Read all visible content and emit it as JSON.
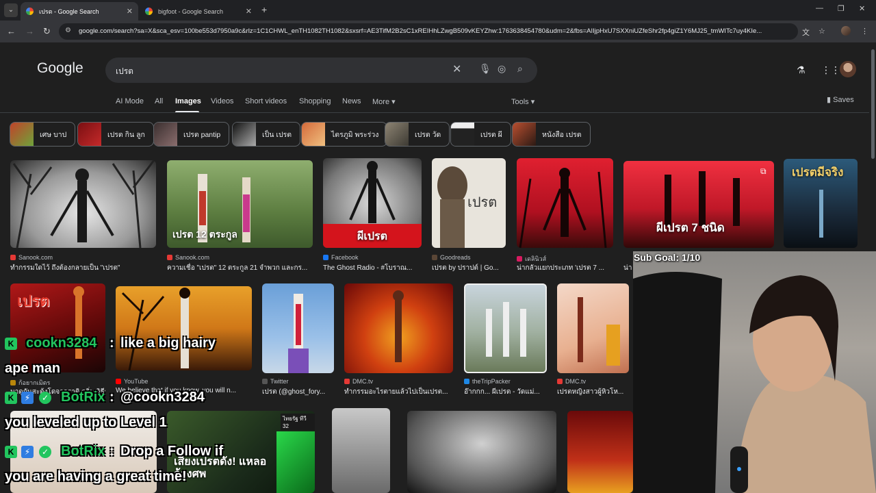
{
  "browser": {
    "tabs": [
      {
        "title": "เปรต - Google Search",
        "active": true
      },
      {
        "title": "bigfoot - Google Search",
        "active": false
      }
    ],
    "url": "google.com/search?sa=X&sca_esv=100be553d7950a9c&rlz=1C1CHWL_enTH1082TH1082&sxsrf=AE3TifM2B2sC1xREIHhLZwgB509vKEYZhw:1763638454780&udm=2&fbs=AIIjpHxU7SXXniUZfeShr2fp4giZ1Y6MJ25_tmWITc7uy4KIe..."
  },
  "google": {
    "logo": "Google",
    "query": "เปรต",
    "tabs": [
      "AI Mode",
      "All",
      "Images",
      "Videos",
      "Short videos",
      "Shopping",
      "News",
      "More"
    ],
    "active_tab": "Images",
    "more_label": "More",
    "tools_label": "Tools",
    "saves_label": "Saves"
  },
  "chips": [
    {
      "label": "เศษ บาป",
      "color": "#a23a1e"
    },
    {
      "label": "เปรต กิน ลูก",
      "color": "#8a1418"
    },
    {
      "label": "เปรต pantip",
      "color": "#4a3a3a"
    },
    {
      "label": "เป็น เปรต",
      "color": "#333333"
    },
    {
      "label": "ไตรภูมิ พระร่วง",
      "color": "#b04a28"
    },
    {
      "label": "เปรต วัด",
      "color": "#5a5346"
    },
    {
      "label": "เปรต ผี",
      "color": "#3d3d3d"
    },
    {
      "label": "หนังสือ เปรต",
      "color": "#6a3424"
    }
  ],
  "row1": [
    {
      "source": "Sanook.com",
      "title": "ทำกรรมใดไว้ ถึงต้องกลายเป็น \"เปรต\"",
      "src_color": "#e53935"
    },
    {
      "source": "Sanook.com",
      "title": "ความเชื่อ \"เปรต\" 12 ตระกูล 21 จำพวก และกร...",
      "overlay": "เปรต 12 ตระกูล",
      "src_color": "#e53935"
    },
    {
      "source": "Facebook",
      "title": "The Ghost Radio - #โบราณ...",
      "overlay": "ผีเปรต",
      "src_color": "#1877f2"
    },
    {
      "source": "Goodreads",
      "title": "เปรต by ปราปต์ | Go...",
      "overlay": "เปรต",
      "src_color": "#5a4636"
    },
    {
      "source": "เดลินิวส์",
      "title": "น่ากลัวแยกประเภท 'เปรต 7 ...",
      "src_color": "#d81b60"
    },
    {
      "source": "",
      "title": "น่า",
      "overlay": "ผีเปรต 7 ชนิด",
      "src_color": "#d81b60"
    },
    {
      "source": "",
      "title": "",
      "overlay": "เปรตมีจริง",
      "src_color": "#888888"
    }
  ],
  "row2": [
    {
      "source": "ก้อยากเมิตร",
      "title": "มาดูกันสะดุ้งโดจากราดิ กลิ่น วิธีรา",
      "overlay": "เปรต",
      "src_color": "#b8860b"
    },
    {
      "source": "YouTube",
      "title": "We believe that if you know, you will n...",
      "src_color": "#ff0000"
    },
    {
      "source": "Twitter",
      "title": "เปรต (@ghost_fory...",
      "src_color": "#555555"
    },
    {
      "source": "DMC.tv",
      "title": "ทำกรรมอะไรตายแล้วไปเป็นเปรต...",
      "src_color": "#e53935"
    },
    {
      "source": "theTripPacker",
      "title": "อ๊ากกก... ผีเปรต - วัดแม่...",
      "src_color": "#1e88e5"
    },
    {
      "source": "DMC.tv",
      "title": "เปรตหญิงสาวผู้หิวโห...",
      "src_color": "#e53935"
    }
  ],
  "row3": [
    {
      "overlay": ""
    },
    {
      "overlay": "เสียงเปรตดัง! แหลอล้างศพ",
      "tag": "ไทยรัฐ ทีวี 32"
    },
    {
      "overlay": ""
    },
    {
      "overlay": ""
    },
    {
      "overlay": ""
    }
  ],
  "stream": {
    "sub_goal": "Sub Goal: 1/10",
    "chat": [
      {
        "user": "cookn3284",
        "sep": " : ",
        "msg": "like a big hairy",
        "msg2": "ape man"
      },
      {
        "user": "BotRix",
        "sep": " : ",
        "msg": "@cookn3284",
        "msg2": "you leveled up to Level 1"
      },
      {
        "user": "BotRix",
        "sep": " : ",
        "msg": "Drop a Follow if",
        "msg2": "you are having a great time!"
      }
    ],
    "badge_k": "K",
    "colors": {
      "user": "#22c55e",
      "msg": "#ffffff",
      "kick": "#22c55e"
    }
  }
}
